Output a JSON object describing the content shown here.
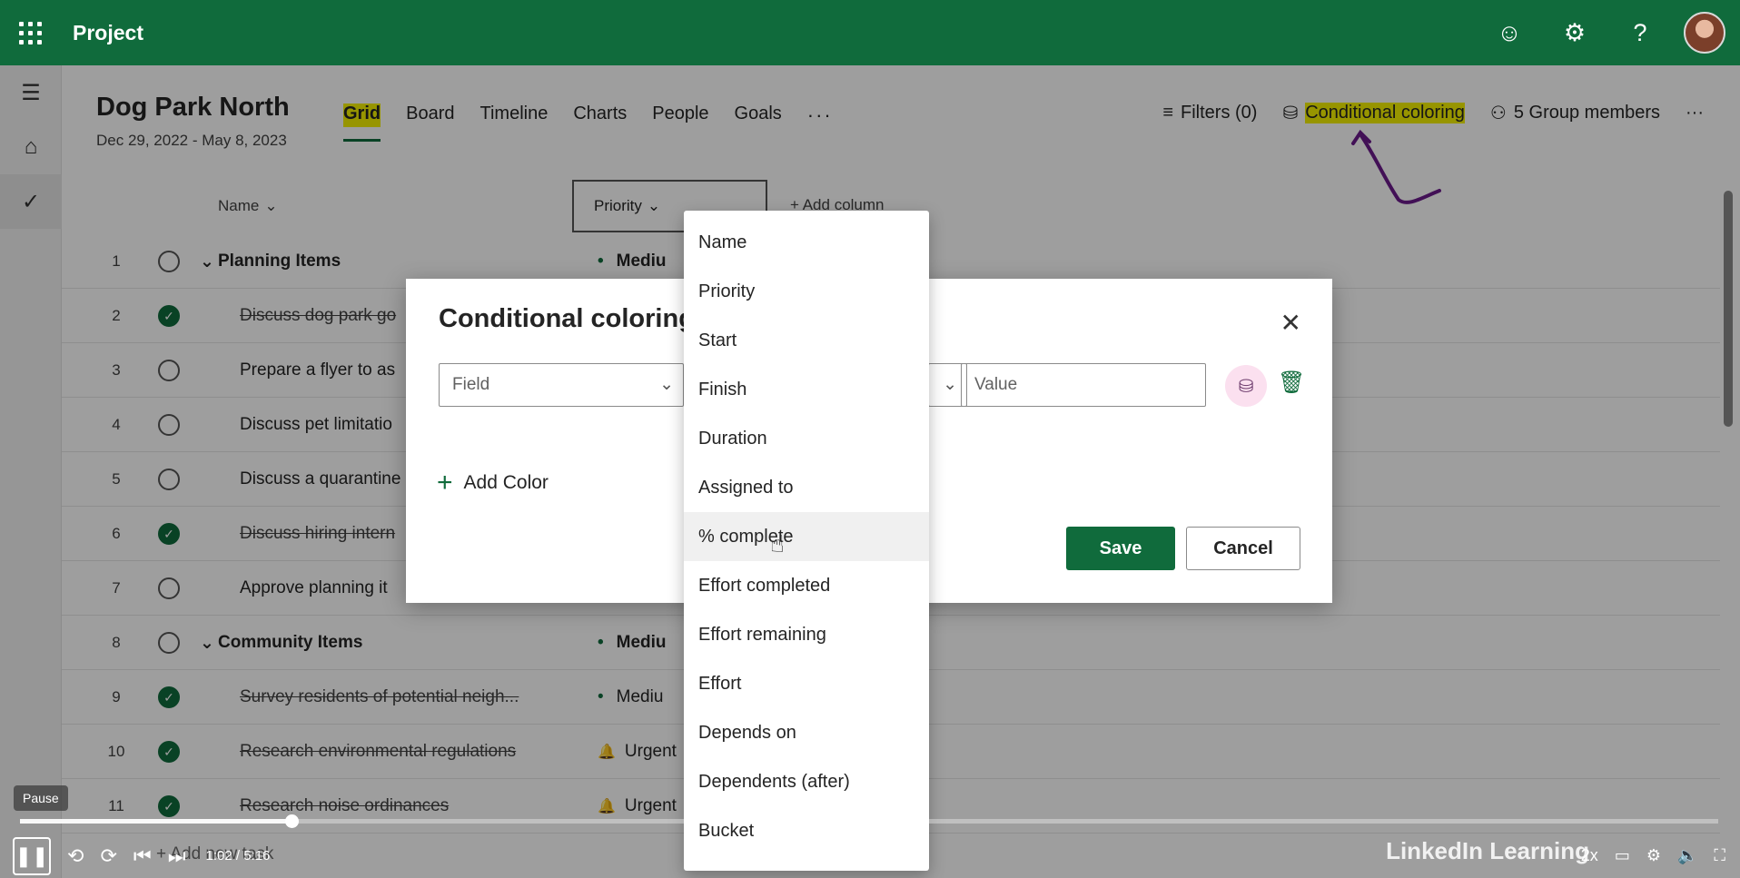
{
  "app": {
    "title": "Project"
  },
  "topbar": {
    "icons": [
      "smiley-icon",
      "gear-icon",
      "help-icon"
    ]
  },
  "project": {
    "title": "Dog Park North",
    "dates": "Dec 29, 2022 - May 8, 2023"
  },
  "tabs": [
    {
      "label": "Grid",
      "active": true
    },
    {
      "label": "Board"
    },
    {
      "label": "Timeline"
    },
    {
      "label": "Charts"
    },
    {
      "label": "People"
    },
    {
      "label": "Goals"
    }
  ],
  "tabs_more": "···",
  "actions": {
    "filters": "Filters (0)",
    "conditional_coloring": "Conditional coloring",
    "group_members": "5 Group members",
    "more": "···"
  },
  "grid": {
    "name_header": "Name",
    "priority_header": "Priority",
    "add_column": "Add column",
    "rows": [
      {
        "num": "1",
        "name": "Planning Items",
        "group": true,
        "done": false,
        "priority": "Mediu",
        "priority_bold": true,
        "priority_icon": "dot"
      },
      {
        "num": "2",
        "name": "Discuss dog park go",
        "done": true,
        "strike": true
      },
      {
        "num": "3",
        "name": "Prepare a flyer to as",
        "done": false
      },
      {
        "num": "4",
        "name": "Discuss pet limitatio",
        "done": false
      },
      {
        "num": "5",
        "name": "Discuss a quarantine",
        "done": false
      },
      {
        "num": "6",
        "name": "Discuss hiring intern",
        "done": true,
        "strike": true
      },
      {
        "num": "7",
        "name": "Approve planning it",
        "done": false
      },
      {
        "num": "8",
        "name": "Community Items",
        "group": true,
        "done": false,
        "priority": "Mediu",
        "priority_bold": true,
        "priority_icon": "dot"
      },
      {
        "num": "9",
        "name": "Survey residents of potential neigh...",
        "done": true,
        "strike": true,
        "priority": "Mediu",
        "priority_icon": "dot"
      },
      {
        "num": "10",
        "name": "Research environmental regulations",
        "done": true,
        "strike": true,
        "priority": "Urgent",
        "priority_icon": "bell"
      },
      {
        "num": "11",
        "name": "Research noise ordinances",
        "done": true,
        "strike": true,
        "priority": "Urgent",
        "priority_icon": "bell"
      }
    ],
    "add_new_task": "Add new task"
  },
  "dialog": {
    "title": "Conditional coloring",
    "field_placeholder": "Field",
    "value_placeholder": "Value",
    "add_color": "Add Color",
    "save": "Save",
    "cancel": "Cancel"
  },
  "dropdown": {
    "options": [
      "Name",
      "Priority",
      "Start",
      "Finish",
      "Duration",
      "Assigned to",
      "% complete",
      "Effort completed",
      "Effort remaining",
      "Effort",
      "Depends on",
      "Dependents (after)",
      "Bucket"
    ],
    "hovered": "% complete"
  },
  "player": {
    "pause_label": "Pause",
    "time": "1:02 / 5:16",
    "progress": 0.16,
    "speed": "2x",
    "brand": "LinkedIn Learning"
  }
}
